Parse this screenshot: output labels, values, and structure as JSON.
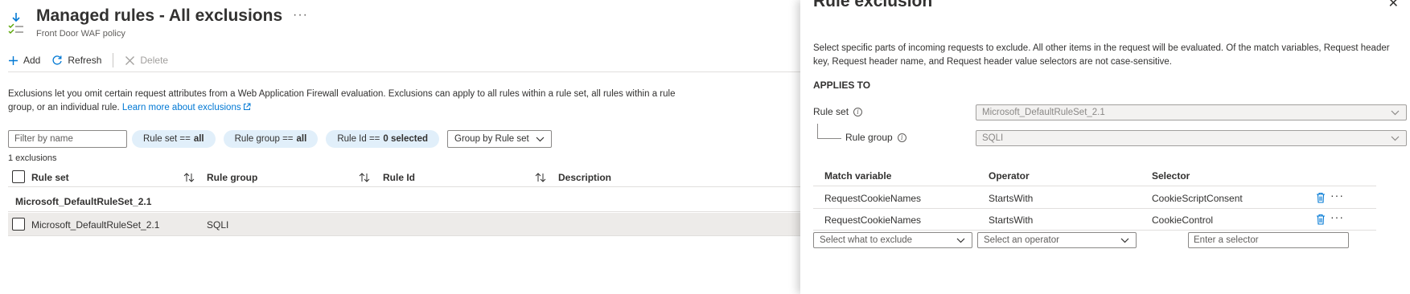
{
  "page": {
    "title": "Managed rules - All exclusions",
    "subtitle": "Front Door WAF policy",
    "more": "···"
  },
  "toolbar": {
    "add": "Add",
    "refresh": "Refresh",
    "delete": "Delete"
  },
  "info": {
    "text": "Exclusions let you omit certain request attributes from a Web Application Firewall evaluation. Exclusions can apply to all rules within a rule set, all rules within a rule group, or an individual rule. ",
    "link": "Learn more about exclusions"
  },
  "filters": {
    "placeholder": "Filter by name",
    "pills": [
      {
        "key": "Rule set == ",
        "value": "all"
      },
      {
        "key": "Rule group == ",
        "value": "all"
      },
      {
        "key": "Rule Id == ",
        "value": "0 selected"
      }
    ],
    "group_by": "Group by Rule set"
  },
  "count": "1 exclusions",
  "table": {
    "columns": [
      "Rule set",
      "Rule group",
      "Rule Id",
      "Description"
    ],
    "group_label": "Microsoft_DefaultRuleSet_2.1",
    "rows": [
      {
        "rule_set": "Microsoft_DefaultRuleSet_2.1",
        "rule_group": "SQLI",
        "rule_id": "",
        "description": ""
      }
    ]
  },
  "panel": {
    "title": "Rule exclusion",
    "close": "✕",
    "description": "Select specific parts of incoming requests to exclude. All other items in the request will be evaluated. Of the match variables, Request header key, Request header name, and Request header value selectors are not case-sensitive.",
    "section": "APPLIES TO",
    "rule_set_label": "Rule set",
    "rule_set_value": "Microsoft_DefaultRuleSet_2.1",
    "rule_group_label": "Rule group",
    "rule_group_value": "SQLI",
    "match_columns": [
      "Match variable",
      "Operator",
      "Selector"
    ],
    "match_rows": [
      {
        "variable": "RequestCookieNames",
        "operator": "StartsWith",
        "selector": "CookieScriptConsent"
      },
      {
        "variable": "RequestCookieNames",
        "operator": "StartsWith",
        "selector": "CookieControl"
      }
    ],
    "new_variable_placeholder": "Select what to exclude",
    "new_operator_placeholder": "Select an operator",
    "new_selector_placeholder": "Enter a selector"
  },
  "colors": {
    "accent": "#0078d4",
    "pill_bg": "#e1effa",
    "row_selected": "#edebe9"
  },
  "icons": [
    "managed-rules-icon",
    "more-icon",
    "add-icon",
    "refresh-icon",
    "delete-icon",
    "external-link-icon",
    "chevron-down-icon",
    "sort-icon",
    "info-icon",
    "close-icon",
    "trash-icon"
  ]
}
